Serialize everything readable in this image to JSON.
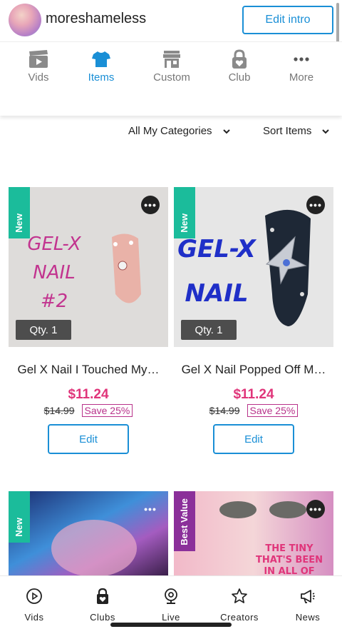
{
  "header": {
    "username": "moreshameless",
    "edit_intro": "Edit intro"
  },
  "tabs": [
    {
      "label": "Vids",
      "icon": "clapperboard-icon",
      "active": false
    },
    {
      "label": "Items",
      "icon": "tshirt-icon",
      "active": true
    },
    {
      "label": "Custom",
      "icon": "storefront-icon",
      "active": false
    },
    {
      "label": "Club",
      "icon": "lock-heart-icon",
      "active": false
    },
    {
      "label": "More",
      "icon": "more-dots-icon",
      "active": false
    }
  ],
  "filters": {
    "categories": "All My Categories",
    "sort": "Sort Items"
  },
  "colors": {
    "accent": "#1a8fd6",
    "price": "#e0357a",
    "save": "#b8328a",
    "ribbon_new": "#1bbc9b",
    "ribbon_best": "#8b2f9a"
  },
  "items": [
    {
      "ribbon": "New",
      "image_text": [
        "GEL-X",
        "NAIL",
        "#2"
      ],
      "qty": "Qty. 1",
      "title": "Gel X Nail I Touched My…",
      "price": "$11.24",
      "old_price": "$14.99",
      "save": "Save 25%",
      "edit": "Edit"
    },
    {
      "ribbon": "New",
      "image_text": [
        "GEL-X",
        "NAIL"
      ],
      "qty": "Qty. 1",
      "title": "Gel X Nail Popped Off M…",
      "price": "$11.24",
      "old_price": "$14.99",
      "save": "Save 25%",
      "edit": "Edit"
    },
    {
      "ribbon": "New"
    },
    {
      "ribbon": "Best Value",
      "image_text": [
        "THE TINY",
        "THAT'S BEEN",
        "IN ALL OF"
      ]
    }
  ],
  "bottom_nav": [
    {
      "label": "Vids",
      "icon": "play-circle-icon"
    },
    {
      "label": "Clubs",
      "icon": "lock-heart-icon"
    },
    {
      "label": "Live",
      "icon": "webcam-icon"
    },
    {
      "label": "Creators",
      "icon": "star-icon"
    },
    {
      "label": "News",
      "icon": "megaphone-icon"
    }
  ]
}
